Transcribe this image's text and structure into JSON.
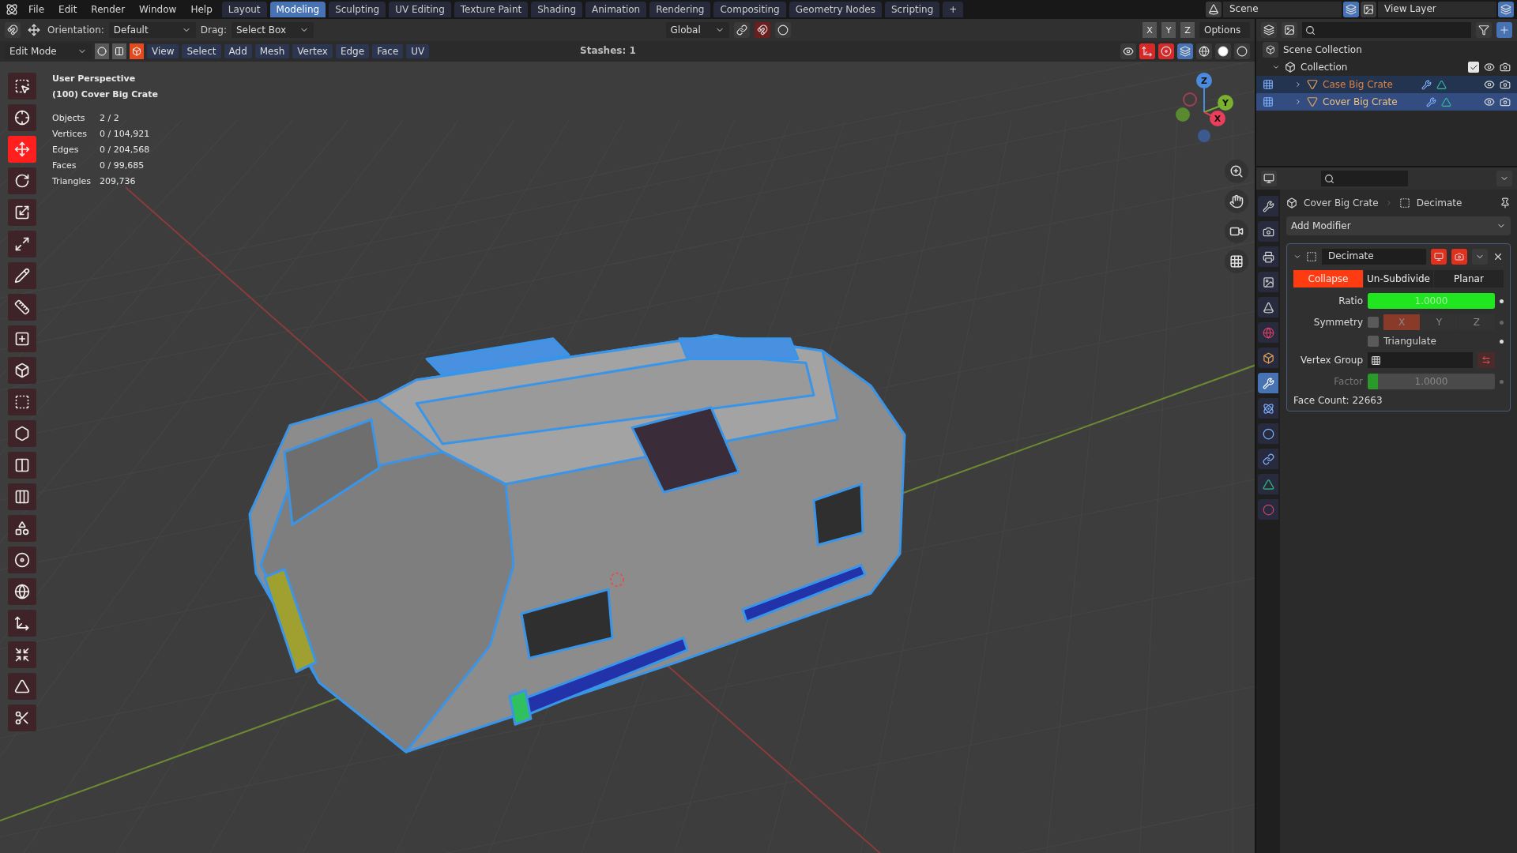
{
  "menu": [
    "File",
    "Edit",
    "Render",
    "Window",
    "Help"
  ],
  "workspaces": [
    {
      "label": "Layout",
      "selected": false
    },
    {
      "label": "Modeling",
      "selected": true
    },
    {
      "label": "Sculpting",
      "selected": false
    },
    {
      "label": "UV Editing",
      "selected": false
    },
    {
      "label": "Texture Paint",
      "selected": false
    },
    {
      "label": "Shading",
      "selected": false
    },
    {
      "label": "Animation",
      "selected": false
    },
    {
      "label": "Rendering",
      "selected": false
    },
    {
      "label": "Compositing",
      "selected": false
    },
    {
      "label": "Geometry Nodes",
      "selected": false
    },
    {
      "label": "Scripting",
      "selected": false
    }
  ],
  "add_workspace": "+",
  "scene": "Scene",
  "view_layer": "View Layer",
  "tool_header": {
    "orientation_label": "Orientation:",
    "orientation": "Default",
    "drag_label": "Drag:",
    "drag": "Select Box",
    "pivot": "Global",
    "options": "Options",
    "mirror_axes": [
      {
        "label": "X",
        "selected": false
      },
      {
        "label": "Y",
        "selected": false
      },
      {
        "label": "Z",
        "selected": false
      }
    ]
  },
  "edit_header": {
    "mode": "Edit Mode",
    "stashes": "Stashes: 1",
    "menus": [
      "View",
      "Select",
      "Add",
      "Mesh",
      "Vertex",
      "Edge",
      "Face",
      "UV"
    ],
    "select_modes": [
      {
        "kind": "vertex",
        "selected": false
      },
      {
        "kind": "edge",
        "selected": false
      },
      {
        "kind": "face",
        "selected": true
      }
    ]
  },
  "viewport": {
    "view": "User Perspective",
    "object": "(100) Cover Big Crate",
    "gizmo": [
      "Z",
      "Y",
      "X"
    ],
    "stats": [
      {
        "label": "Objects",
        "value": "2 / 2"
      },
      {
        "label": "Vertices",
        "value": "0 / 104,921"
      },
      {
        "label": "Edges",
        "value": "0 / 204,568"
      },
      {
        "label": "Faces",
        "value": "0 / 99,685"
      },
      {
        "label": "Triangles",
        "value": "209,736"
      }
    ]
  },
  "tools": [
    {
      "kind": "select",
      "selected": false
    },
    {
      "kind": "cursor",
      "selected": false
    },
    {
      "kind": "move",
      "selected": true
    },
    {
      "kind": "rotate",
      "selected": false
    },
    {
      "kind": "scale",
      "selected": false
    },
    {
      "kind": "transform",
      "selected": false
    },
    {
      "kind": "annotate",
      "selected": false
    },
    {
      "kind": "measure",
      "selected": false
    },
    {
      "kind": "add",
      "selected": false
    },
    {
      "kind": "extrude",
      "selected": false
    },
    {
      "kind": "inset",
      "selected": false
    },
    {
      "kind": "bevel",
      "selected": false
    },
    {
      "kind": "loopcut",
      "selected": false
    },
    {
      "kind": "knife",
      "selected": false
    },
    {
      "kind": "polybuild",
      "selected": false
    },
    {
      "kind": "spin",
      "selected": false
    },
    {
      "kind": "smooth",
      "selected": false
    },
    {
      "kind": "slide",
      "selected": false
    },
    {
      "kind": "shrink",
      "selected": false
    },
    {
      "kind": "shear",
      "selected": false
    },
    {
      "kind": "rip",
      "selected": false
    }
  ],
  "outliner": {
    "root": "Scene Collection",
    "collection": {
      "name": "Collection",
      "checked": true,
      "expanded": true,
      "children": [
        {
          "name": "Case Big Crate",
          "selected": true,
          "active": false
        },
        {
          "name": "Cover Big Crate",
          "selected": true,
          "active": true
        }
      ]
    }
  },
  "properties": {
    "object": "Cover Big Crate",
    "modifier": "Decimate",
    "add_modifier": "Add Modifier",
    "tabs": [
      {
        "kind": "tool",
        "selected": false
      },
      {
        "kind": "render",
        "selected": false
      },
      {
        "kind": "output",
        "selected": false
      },
      {
        "kind": "viewlayer",
        "selected": false
      },
      {
        "kind": "scene",
        "selected": false
      },
      {
        "kind": "world",
        "selected": false
      },
      {
        "kind": "object",
        "selected": false
      },
      {
        "kind": "modifier",
        "selected": true
      },
      {
        "kind": "particles",
        "selected": false
      },
      {
        "kind": "physics",
        "selected": false
      },
      {
        "kind": "constraints",
        "selected": false
      },
      {
        "kind": "data",
        "selected": false
      },
      {
        "kind": "material",
        "selected": false
      }
    ],
    "panel": {
      "name": "Decimate",
      "expanded": true,
      "modes": [
        {
          "label": "Collapse",
          "selected": true
        },
        {
          "label": "Un-Subdivide",
          "selected": false
        },
        {
          "label": "Planar",
          "selected": false
        }
      ],
      "ratio": {
        "label": "Ratio",
        "value": "1.0000",
        "level": 1
      },
      "symmetry": {
        "label": "Symmetry",
        "checked": false,
        "axes": [
          {
            "label": "X",
            "selected": true
          },
          {
            "label": "Y",
            "selected": false
          },
          {
            "label": "Z",
            "selected": false
          }
        ]
      },
      "triangulate": {
        "label": "Triangulate",
        "checked": false
      },
      "vertex_group": {
        "label": "Vertex Group"
      },
      "factor": {
        "label": "Factor",
        "value": "1.0000",
        "level": 0.08,
        "disabled": true
      },
      "face_count": "Face Count: 22663"
    }
  }
}
